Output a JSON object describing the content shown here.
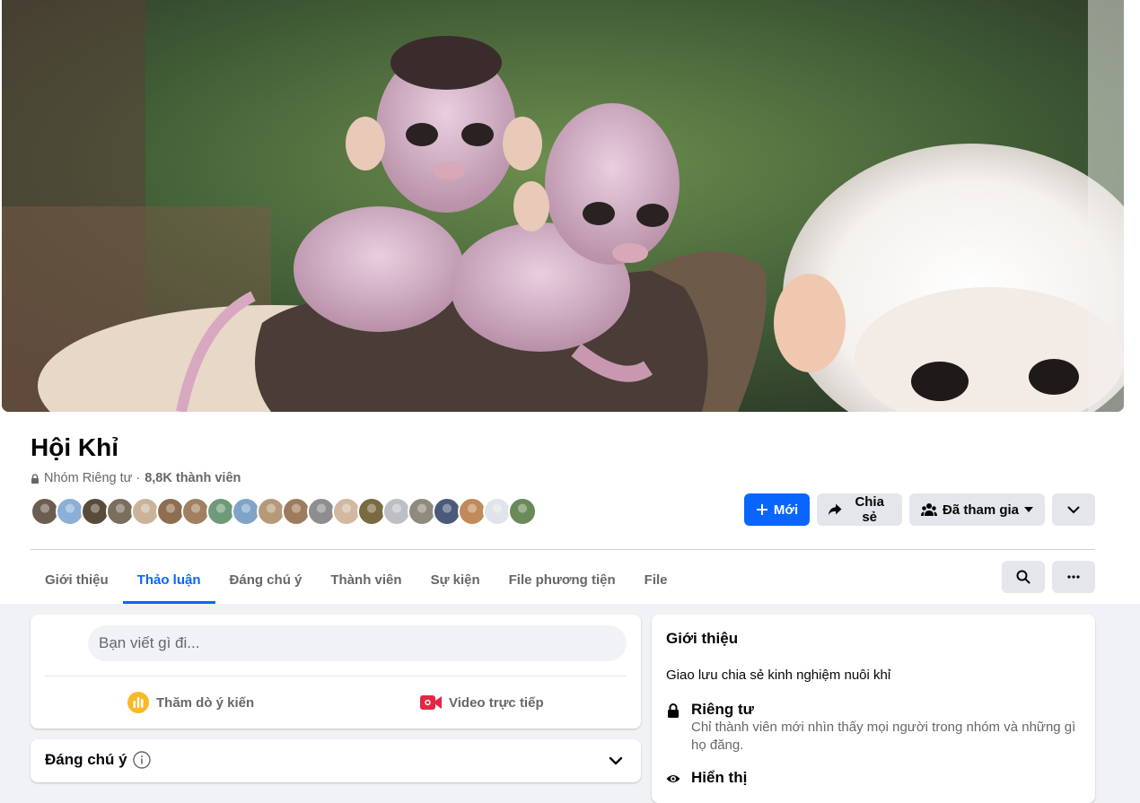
{
  "group": {
    "name": "Hội Khỉ",
    "privacy": "Nhóm Riêng tư ·",
    "members": "8,8K thành viên"
  },
  "avatars": [
    "#6b5d52",
    "#8ab0d6",
    "#5a4a3a",
    "#7a6e5e",
    "#c9b49a",
    "#8d6e4f",
    "#a08060",
    "#6f9a7a",
    "#7fa4c8",
    "#b59a7a",
    "#9c7c5c",
    "#8e8e8e",
    "#d2b8a0",
    "#7a6a40",
    "#bcc0c4",
    "#8f8a7e",
    "#4a5a7a",
    "#c08a5a",
    "#e0e4e8",
    "#6a8a5a"
  ],
  "actions": {
    "new_label": "Mới",
    "share_label": "Chia sẻ",
    "joined_label": "Đã tham gia"
  },
  "tabs": [
    "Giới thiệu",
    "Thảo luận",
    "Đáng chú ý",
    "Thành viên",
    "Sự kiện",
    "File phương tiện",
    "File"
  ],
  "composer": {
    "placeholder": "Bạn viết gì đi...",
    "poll_label": "Thăm dò ý kiến",
    "live_label": "Video trực tiếp"
  },
  "featured": {
    "title": "Đáng chú ý"
  },
  "about": {
    "title": "Giới thiệu",
    "description": "Giao lưu chia sẻ kinh nghiệm nuôi khỉ",
    "private_title": "Riêng tư",
    "private_desc": "Chỉ thành viên mới nhìn thấy mọi người trong nhóm và những gì họ đăng.",
    "visible_title": "Hiển thị"
  },
  "colors": {
    "primary": "#0866ff",
    "grey_button": "#e4e6eb",
    "page_bg": "#f0f2f5"
  }
}
